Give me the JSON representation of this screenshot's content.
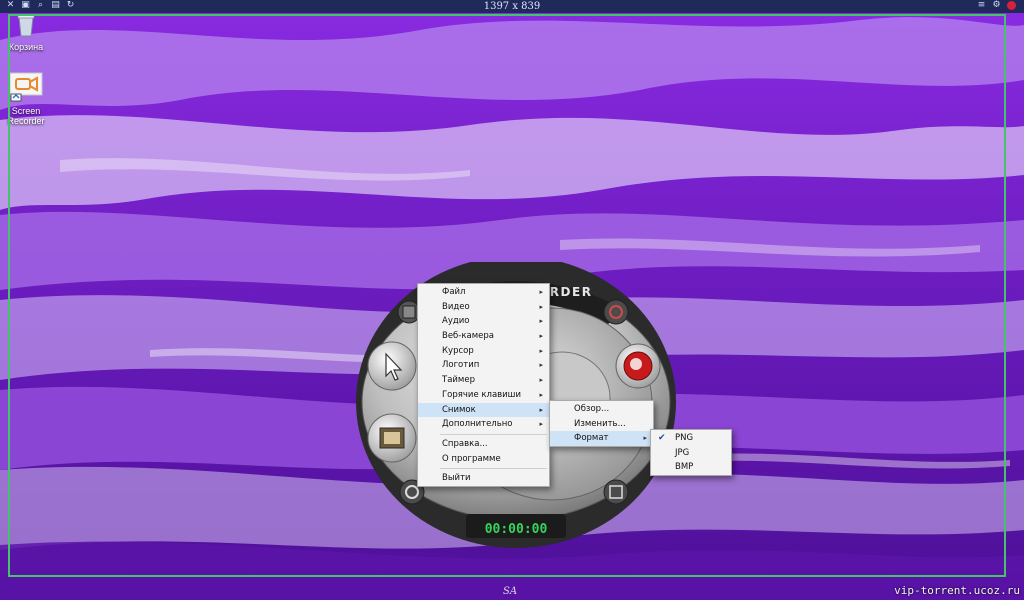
{
  "topbar": {
    "dimensions": "1397 x 839"
  },
  "desktop": {
    "recycle_bin_label": "Корзина",
    "recorder_icon_label": "Screen Recorder"
  },
  "recorder": {
    "brand_text": "SCREEN RECORDER",
    "timer": "00:00:00"
  },
  "menus": {
    "main": [
      {
        "label": "Файл",
        "submenu": true
      },
      {
        "label": "Видео",
        "submenu": true
      },
      {
        "label": "Аудио",
        "submenu": true
      },
      {
        "label": "Веб-камера",
        "submenu": true
      },
      {
        "label": "Курсор",
        "submenu": true
      },
      {
        "label": "Логотип",
        "submenu": true
      },
      {
        "label": "Таймер",
        "submenu": true
      },
      {
        "label": "Горячие клавиши",
        "submenu": true
      },
      {
        "label": "Снимок",
        "submenu": true,
        "highlighted": true
      },
      {
        "label": "Дополнительно",
        "submenu": true
      },
      {
        "label": "Справка..."
      },
      {
        "label": "О программе"
      },
      {
        "label": "Выйти"
      }
    ],
    "snapshot": [
      {
        "label": "Обзор..."
      },
      {
        "label": "Изменить..."
      },
      {
        "label": "Формат",
        "submenu": true,
        "highlighted": true
      }
    ],
    "format": [
      {
        "label": "PNG",
        "checked": true
      },
      {
        "label": "JPG"
      },
      {
        "label": "BMP"
      }
    ]
  },
  "footer": {
    "signature": "SA",
    "watermark": "vip-torrent.ucoz.ru"
  },
  "colors": {
    "frame": "#43c46a",
    "menu_highlight": "#cfe3f7",
    "timer": "#36d45a",
    "wallpaper_primary": "#7a1fd6"
  }
}
